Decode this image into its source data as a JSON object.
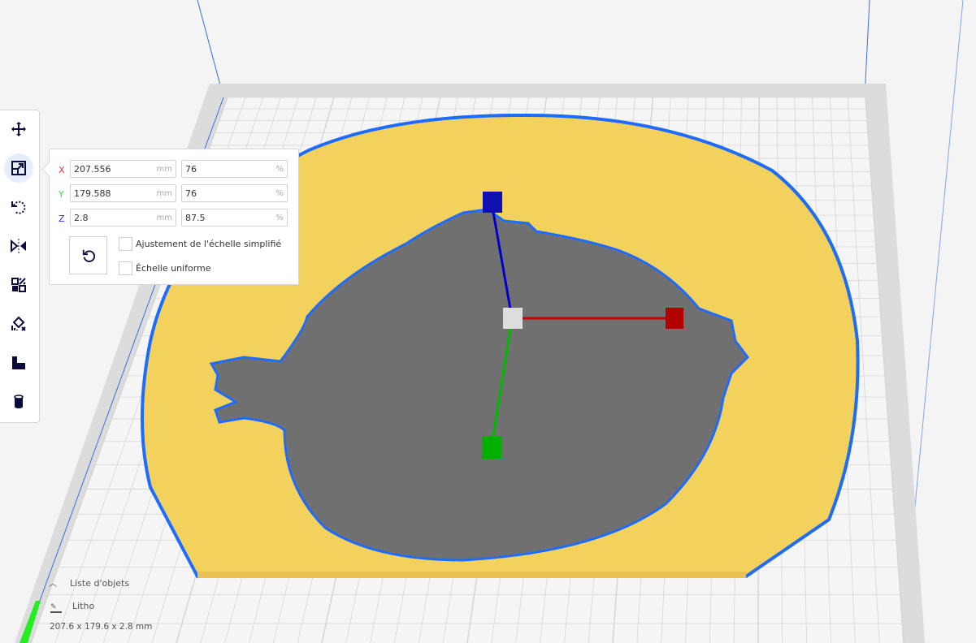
{
  "toolbar": {
    "tools": [
      {
        "name": "move",
        "icon": "move-icon"
      },
      {
        "name": "scale",
        "icon": "scale-icon",
        "active": true
      },
      {
        "name": "rotate",
        "icon": "rotate-icon"
      },
      {
        "name": "mirror",
        "icon": "mirror-icon"
      },
      {
        "name": "per-model-settings",
        "icon": "per-model-settings-icon"
      },
      {
        "name": "support-blocker",
        "icon": "support-blocker-icon"
      },
      {
        "name": "support",
        "icon": "support-icon"
      },
      {
        "name": "cylinder",
        "icon": "cylinder-icon"
      }
    ]
  },
  "scale_panel": {
    "x": {
      "label": "X",
      "mm": "207.556",
      "percent": "76"
    },
    "y": {
      "label": "Y",
      "mm": "179.588",
      "percent": "76"
    },
    "z": {
      "label": "Z",
      "mm": "2.8",
      "percent": "87.5"
    },
    "unit_mm": "mm",
    "unit_percent": "%",
    "snap_scaling_label": "Ajustement de l'échelle simplifié",
    "uniform_scaling_label": "Échelle uniforme",
    "colors": {
      "x": "#e53935",
      "y": "#43d13f",
      "z": "#3030e0"
    }
  },
  "object_list": {
    "header": "Liste d'objets",
    "object_name": "Litho",
    "dimensions": "207.6 x 179.6 x 2.8 mm"
  },
  "colors": {
    "model": "#f5d86a",
    "outline": "#1e6cff",
    "plate": "#f2f2f2",
    "gizmo_x": "#cc0000",
    "gizmo_y": "#00bb00",
    "gizmo_z": "#0000cc"
  }
}
